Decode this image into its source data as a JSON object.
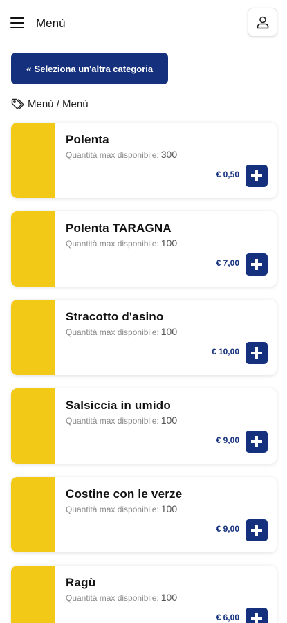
{
  "header": {
    "title": "Menù",
    "menu_icon": "hamburger-menu-icon",
    "user_icon": "user-icon"
  },
  "back_button": {
    "chevron": "«",
    "label": "Seleziona un'altra categoria"
  },
  "breadcrumb": {
    "icon": "tag-icon",
    "text": "Menù / Menù"
  },
  "colors": {
    "accent": "#15317d",
    "thumbnail": "#f3c918"
  },
  "products": [
    {
      "name": "Polenta",
      "qty_label": "Quantità max disponibile:",
      "qty": "300",
      "price": "€ 0,50"
    },
    {
      "name": "Polenta TARAGNA",
      "qty_label": "Quantità max disponibile:",
      "qty": "100",
      "price": "€ 7,00"
    },
    {
      "name": "Stracotto d'asino",
      "qty_label": "Quantità max disponibile:",
      "qty": "100",
      "price": "€ 10,00"
    },
    {
      "name": "Salsiccia in umido",
      "qty_label": "Quantità max disponibile:",
      "qty": "100",
      "price": "€ 9,00"
    },
    {
      "name": "Costine con le verze",
      "qty_label": "Quantità max disponibile:",
      "qty": "100",
      "price": "€ 9,00"
    },
    {
      "name": "Ragù",
      "qty_label": "Quantità max disponibile:",
      "qty": "100",
      "price": "€ 6,00"
    }
  ]
}
